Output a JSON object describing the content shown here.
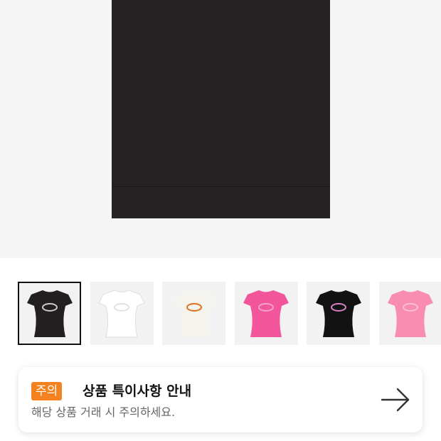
{
  "notice": {
    "badge": "주의",
    "title": "상품 특이사항 안내",
    "description": "해당 상품 거래 시 주의하세요."
  },
  "thumbnails": [
    {
      "name": "thumbnail-black-silver-logo",
      "shirt_color": "#231f21",
      "logo_color": "#c9c9c9",
      "selected": true
    },
    {
      "name": "thumbnail-white",
      "shirt_color": "#ffffff",
      "logo_color": "#e2e2e2",
      "selected": false
    },
    {
      "name": "thumbnail-white-orange-logo",
      "shirt_color": "#f4f3ee",
      "logo_color": "#e07020",
      "selected": false
    },
    {
      "name": "thumbnail-pink",
      "shirt_color": "#f2559a",
      "logo_color": "#f7a0c6",
      "selected": false
    },
    {
      "name": "thumbnail-black-pink-logo",
      "shirt_color": "#121212",
      "logo_color": "#d47ec4",
      "selected": false
    },
    {
      "name": "thumbnail-light-pink",
      "shirt_color": "#f98cb1",
      "logo_color": "#fbbfd2",
      "selected": false
    }
  ],
  "colors": {
    "accent": "#f58220",
    "hero_background": "#f5f5f5",
    "hero_shirt": "#262224"
  },
  "icons": {
    "notice_arrow": "arrow-right-icon"
  }
}
